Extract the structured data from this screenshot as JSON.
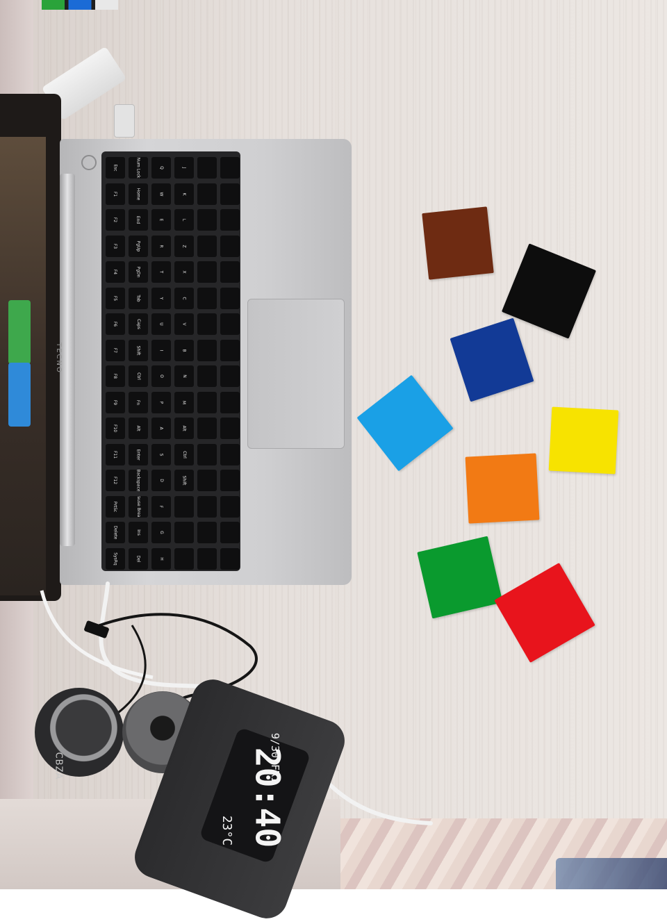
{
  "scene": {
    "description_colors": {
      "brown": "#6e2b12",
      "black": "#0d0d0d",
      "navy": "#123a96",
      "light_blue": "#1aa0e6",
      "yellow": "#f7e300",
      "orange": "#f27a14",
      "green": "#0a9a2e",
      "red": "#e8141c"
    }
  },
  "laptop": {
    "brand": "TECNO"
  },
  "keyboard": {
    "keys": [
      "Esc",
      "F1",
      "F2",
      "F3",
      "F4",
      "F5",
      "F6",
      "F7",
      "F8",
      "F9",
      "F10",
      "F11",
      "F12",
      "PrtSc",
      "Delete",
      "SysRq",
      "Num Lock",
      "Home",
      "End",
      "PgUp",
      "PgDn",
      "Tab",
      "Caps",
      "Shift",
      "Ctrl",
      "Fn",
      "Alt",
      "Enter",
      "Backspace",
      "Pause Break",
      "Ins",
      "Del",
      "Q",
      "W",
      "E",
      "R",
      "T",
      "Y",
      "U",
      "I",
      "O",
      "P",
      "A",
      "S",
      "D",
      "F",
      "G",
      "H",
      "J",
      "K",
      "L",
      "Z",
      "X",
      "C",
      "V",
      "B",
      "N",
      "M",
      "Alt",
      "Ctrl",
      "Shift"
    ]
  },
  "clock": {
    "time": "20:40",
    "date": "9/30 FRI",
    "temperature": "23°C"
  },
  "charger": {
    "brand": "CBZA"
  }
}
